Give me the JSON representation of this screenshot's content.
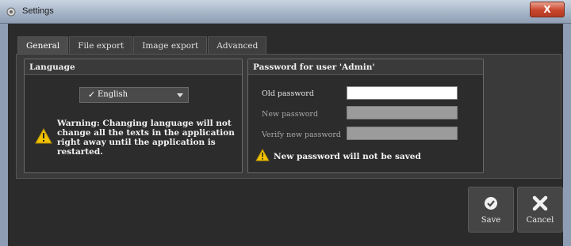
{
  "window": {
    "title": "Settings",
    "close_label": "X"
  },
  "tabs": [
    {
      "label": "General",
      "active": true
    },
    {
      "label": "File export",
      "active": false
    },
    {
      "label": "Image export",
      "active": false
    },
    {
      "label": "Advanced",
      "active": false
    }
  ],
  "language": {
    "header": "Language",
    "selected": "English",
    "warning": "Warning: Changing language will not change all the texts in the application right away until the application is restarted."
  },
  "password": {
    "header": "Password for user 'Admin'",
    "old_label": "Old password",
    "new_label": "New password",
    "verify_label": "Verify new password",
    "old_value": "",
    "new_value": "",
    "verify_value": "",
    "warning": "New password will not be saved"
  },
  "buttons": {
    "save_label": "Save",
    "cancel_label": "Cancel"
  },
  "colors": {
    "warning_yellow": "#f2c200",
    "panel_bg": "#2c2c2c",
    "disabled_field": "#9b9b9b"
  },
  "icons": {
    "app": "gear-icon",
    "check": "check-icon",
    "warning": "warning-icon",
    "save": "checkmark-circle-icon",
    "cancel": "x-icon"
  }
}
